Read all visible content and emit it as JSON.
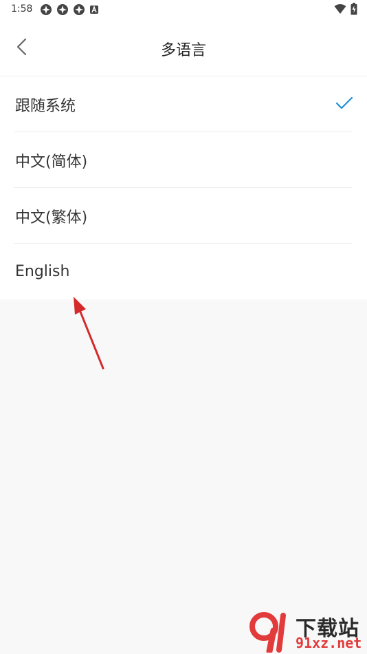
{
  "status_bar": {
    "time": "1:58",
    "left_icons": [
      "app-notification-icon",
      "app-notification-icon",
      "app-notification-icon",
      "a-badge-icon"
    ],
    "right_icons": [
      "wifi-icon",
      "battery-charging-icon"
    ]
  },
  "header": {
    "title": "多语言",
    "back_icon": "chevron-left-icon"
  },
  "languages": [
    {
      "label": "跟随系统",
      "selected": true
    },
    {
      "label": "中文(简体)",
      "selected": false
    },
    {
      "label": "中文(繁体)",
      "selected": false
    },
    {
      "label": "English",
      "selected": false
    }
  ],
  "watermark": {
    "title": "下载站",
    "domain": "91xz.net"
  },
  "colors": {
    "accent": "#1e90d6",
    "arrow": "#d42a2a",
    "background": "#f8f8f8"
  }
}
